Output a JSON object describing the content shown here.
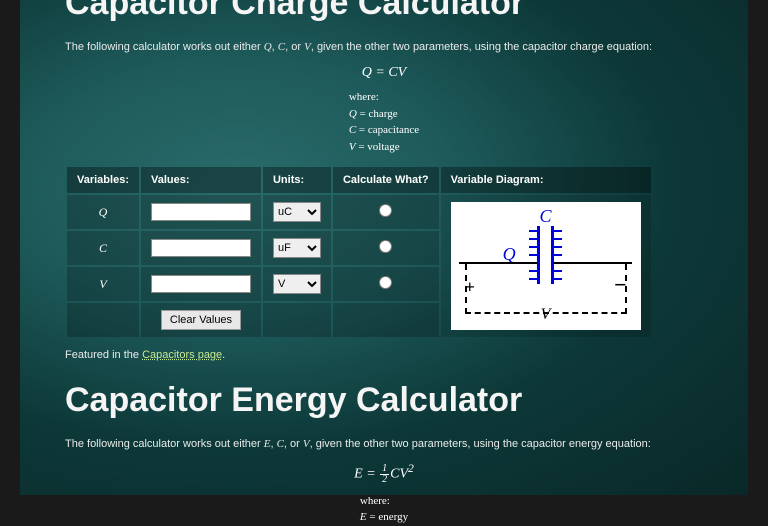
{
  "section1": {
    "title": "Capacitor Charge Calculator",
    "intro_pre": "The following calculator works out either ",
    "intro_v1": "Q",
    "intro_v2": "C",
    "intro_v3": "V",
    "intro_sep": ", ",
    "intro_or": ", or ",
    "intro_post": ", given the other two parameters, using the capacitor charge equation:",
    "equation": "Q = CV",
    "where_label": "where:",
    "where_lines": [
      {
        "sym": "Q",
        "txt": " = charge"
      },
      {
        "sym": "C",
        "txt": " = capacitance"
      },
      {
        "sym": "V",
        "txt": " = voltage"
      }
    ],
    "headers": {
      "variables": "Variables:",
      "values": "Values:",
      "units": "Units:",
      "calc": "Calculate What?",
      "diagram": "Variable Diagram:"
    },
    "rows": [
      {
        "var": "Q",
        "unit": "uC"
      },
      {
        "var": "C",
        "unit": "uF"
      },
      {
        "var": "V",
        "unit": "V"
      }
    ],
    "clear_btn": "Clear Values",
    "featured_pre": "Featured in the ",
    "featured_link": "Capacitors page",
    "featured_post": ".",
    "diag": {
      "C": "C",
      "Q": "Q",
      "V": "V",
      "plus": "+",
      "minus": "−"
    }
  },
  "section2": {
    "title": "Capacitor Energy Calculator",
    "intro_pre": "The following calculator works out either ",
    "intro_v1": "E",
    "intro_v2": "C",
    "intro_v3": "V",
    "intro_sep": ", ",
    "intro_or": ", or ",
    "intro_post": ", given the other two parameters, using the capacitor energy equation:",
    "eq_E": "E",
    "eq_eq": " = ",
    "eq_half_n": "1",
    "eq_half_d": "2",
    "eq_C": "C",
    "eq_V": "V",
    "eq_sq": "2",
    "where_label": "where:",
    "where_lines": [
      {
        "sym": "E",
        "txt": " = energy"
      }
    ]
  }
}
